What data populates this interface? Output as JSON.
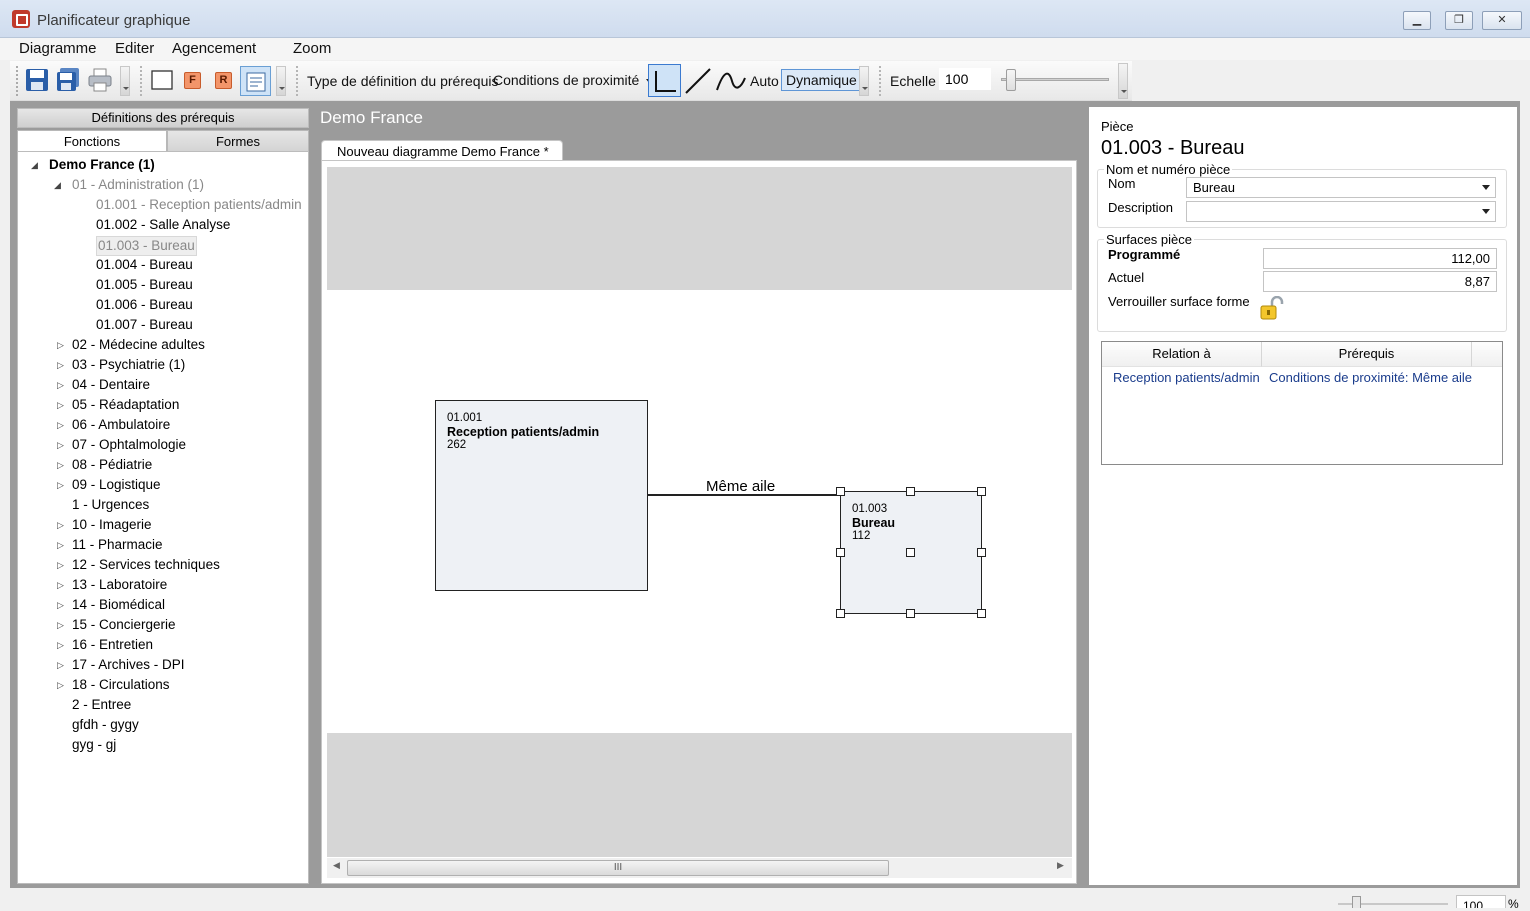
{
  "window": {
    "title": "Planificateur graphique",
    "btn_min": "▁",
    "btn_max": "❐",
    "btn_close": "✕"
  },
  "menu": {
    "items": [
      "Diagramme",
      "Editer",
      "Agencement",
      "Zoom"
    ]
  },
  "toolbar": {
    "prereq_type_label": "Type de définition du prérequis",
    "prereq_type_value": "Conditions de proximité",
    "auto_label": "Auto",
    "dynamic_label": "Dynamique",
    "scale_label": "Echelle",
    "scale_value": "100",
    "scale_slider_level": 0.05,
    "f_button": "F",
    "r_button": "R"
  },
  "left": {
    "header": "Définitions des prérequis",
    "tabs": [
      "Fonctions",
      "Formes"
    ],
    "tree": {
      "root": "Demo France  (1)",
      "group_admin": "01 - Administration  (1)",
      "children": [
        "01.001 - Reception patients/admin",
        "01.002 - Salle Analyse",
        "01.003 - Bureau",
        "01.004 - Bureau",
        "01.005 - Bureau",
        "01.006 - Bureau",
        "01.007 - Bureau"
      ],
      "groups": [
        "02 - Médecine adultes",
        "03 - Psychiatrie  (1)",
        "04 - Dentaire",
        "05 - Réadaptation",
        "06 - Ambulatoire",
        "07 - Ophtalmologie",
        "08 - Pédiatrie",
        "09 - Logistique",
        "1 - Urgences",
        "10 - Imagerie",
        "11 - Pharmacie",
        "12 - Services techniques",
        "13 - Laboratoire",
        "14 - Biomédical",
        "15 - Conciergerie",
        "16 - Entretien",
        "17 - Archives - DPI",
        "18 - Circulations",
        "2 - Entree",
        "gfdh - gygy",
        "gyg - gj"
      ]
    }
  },
  "center": {
    "title": "Demo France",
    "doc_tab": "Nouveau diagramme Demo France *",
    "shapes": [
      {
        "code": "01.001",
        "name": "Reception patients/admin",
        "size": "262"
      },
      {
        "code": "01.003",
        "name": "Bureau",
        "size": "112"
      }
    ],
    "connector_label": "Même aile",
    "scroll_thumb": "III"
  },
  "right": {
    "section_label": "Pièce",
    "room_title": "01.003 - Bureau",
    "group_name_title": "Nom et numéro pièce",
    "nom_label": "Nom",
    "nom_value": "Bureau",
    "description_label": "Description",
    "description_value": "",
    "group_surface_title": "Surfaces pièce",
    "programme_label": "Programmé",
    "programme_value": "112,00",
    "actuel_label": "Actuel",
    "actuel_value": "8,87",
    "lock_label": "Verrouiller surface forme",
    "grid_headers": [
      "Relation à",
      "Prérequis"
    ],
    "grid_rows": [
      {
        "relation": "Reception patients/admin",
        "prereq": "Conditions de proximité: Même aile"
      }
    ]
  },
  "status": {
    "zoom_value": "100",
    "zoom_unit": "%"
  }
}
